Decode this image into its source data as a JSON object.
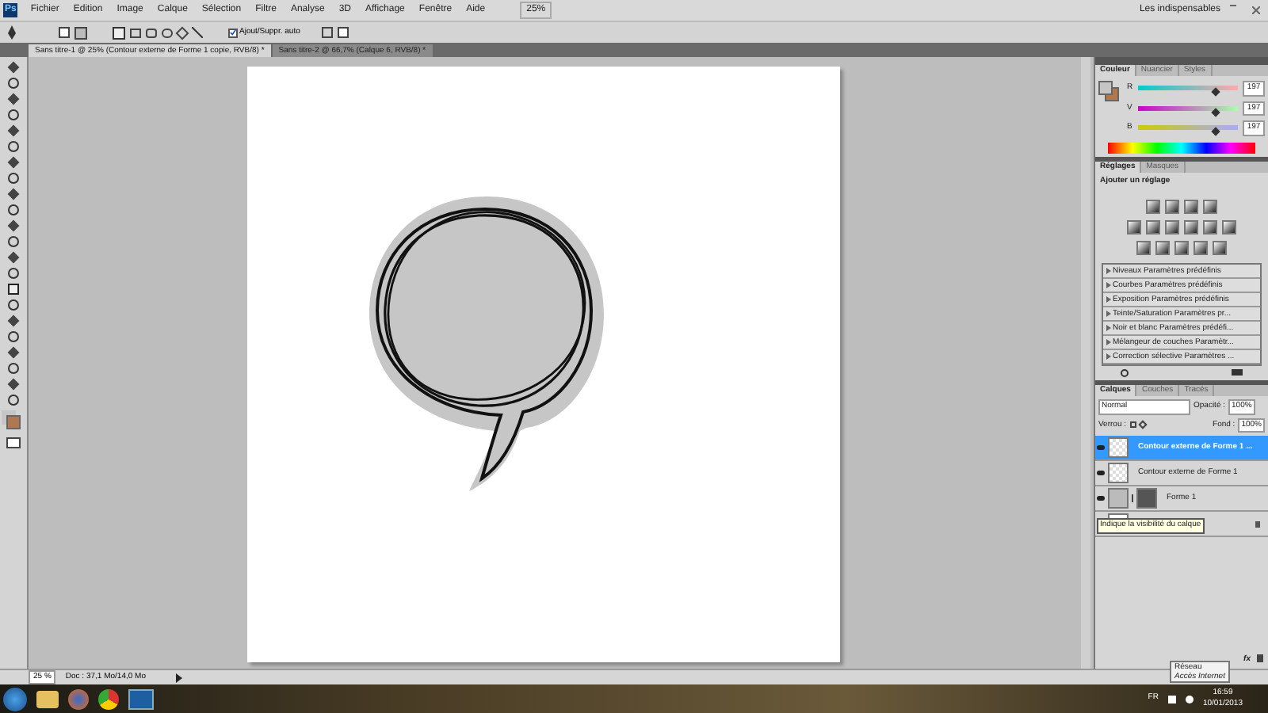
{
  "app": {
    "logo": "Ps",
    "zoom": "25%",
    "workspace": "Les indispensables"
  },
  "menu": [
    "Fichier",
    "Edition",
    "Image",
    "Calque",
    "Sélection",
    "Filtre",
    "Analyse",
    "3D",
    "Affichage",
    "Fenêtre",
    "Aide"
  ],
  "options_bar": {
    "auto_add_delete": {
      "label": "Ajout/Suppr. auto",
      "checked": true
    }
  },
  "doc_tabs": [
    {
      "label": "Sans titre-1 @ 25% (Contour externe de Forme 1 copie, RVB/8) *",
      "selected": true
    },
    {
      "label": "Sans titre-2 @ 66,7% (Calque 6, RVB/8) *",
      "selected": false
    }
  ],
  "color_panel": {
    "tabs": [
      {
        "label": "Couleur",
        "selected": true
      },
      {
        "label": "Nuancier",
        "selected": false
      },
      {
        "label": "Styles",
        "selected": false
      }
    ],
    "sliders": [
      {
        "label": "R",
        "value": "197",
        "level": 0.77
      },
      {
        "label": "V",
        "value": "197",
        "level": 0.77
      },
      {
        "label": "B",
        "value": "197",
        "level": 0.77
      }
    ]
  },
  "adjustments_panel": {
    "tabs": [
      {
        "label": "Réglages",
        "selected": true
      },
      {
        "label": "Masques",
        "selected": false
      }
    ],
    "title": "Ajouter un réglage",
    "presets": [
      "Niveaux Paramètres prédéfinis",
      "Courbes Paramètres prédéfinis",
      "Exposition Paramètres prédéfinis",
      "Teinte/Saturation Paramètres pr...",
      "Noir et blanc Paramètres prédéfi...",
      "Mélangeur de couches Paramètr...",
      "Correction sélective Paramètres ..."
    ]
  },
  "layers_panel": {
    "tabs": [
      {
        "label": "Calques",
        "selected": true
      },
      {
        "label": "Couches",
        "selected": false
      },
      {
        "label": "Tracés",
        "selected": false
      }
    ],
    "blend_mode": "Normal",
    "opacity_label": "Opacité :",
    "opacity": "100%",
    "lock_label": "Verrou :",
    "fill_label": "Fond :",
    "fill": "100%",
    "layers": [
      {
        "kind": "pixel",
        "name": "Contour externe de Forme 1 ...",
        "selected": true
      },
      {
        "kind": "pixel",
        "name": "Contour externe de Forme 1",
        "selected": false
      },
      {
        "kind": "shape",
        "name": "Forme 1",
        "selected": false
      },
      {
        "kind": "background",
        "selected": false
      }
    ],
    "tooltip": "Indique la visibilité du calque",
    "effects_button": "fx"
  },
  "status_bar": {
    "zoom": "25 %",
    "doc": "Doc : 37,1 Mo/14,0 Mo"
  },
  "taskbar": {
    "language": "FR",
    "time": "16:59",
    "date": "10/01/2013",
    "tooltip": [
      "Réseau",
      "Accès Internet"
    ]
  }
}
